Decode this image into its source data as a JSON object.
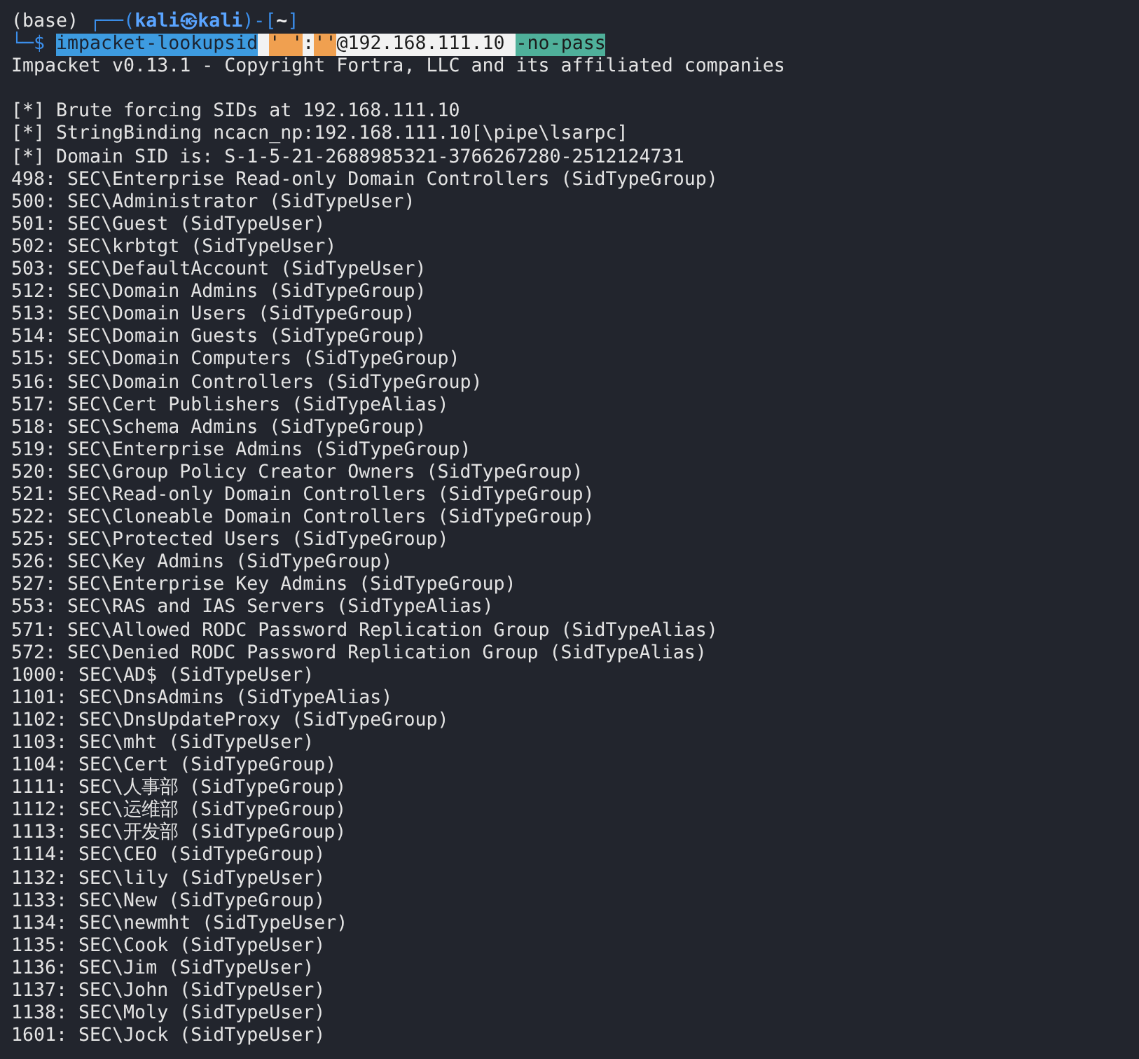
{
  "prompt": {
    "env": "(base)",
    "frame_open": "┌──(",
    "user": "kali",
    "at": "㉿",
    "host": "kali",
    "frame_mid": ")-[",
    "path": "~",
    "frame_close": "]",
    "corner": "└─",
    "symbol": "$",
    "segments": [
      {
        "text": "impacket-lookupsid",
        "kind": "command"
      },
      {
        "text": "' '",
        "kind": "string"
      },
      {
        "text": ":",
        "kind": "highlight"
      },
      {
        "text": "''",
        "kind": "string"
      },
      {
        "text": "@192.168.111.10 ",
        "kind": "highlight"
      },
      {
        "text": "-no-pass",
        "kind": "option"
      }
    ]
  },
  "banner": "Impacket v0.13.1 - Copyright Fortra, LLC and its affiliated companies",
  "status_lines": [
    "[*] Brute forcing SIDs at 192.168.111.10",
    "[*] StringBinding ncacn_np:192.168.111.10[\\pipe\\lsarpc]",
    "[*] Domain SID is: S-1-5-21-2688985321-3766267280-2512124731"
  ],
  "sids": [
    "498: SEC\\Enterprise Read-only Domain Controllers (SidTypeGroup)",
    "500: SEC\\Administrator (SidTypeUser)",
    "501: SEC\\Guest (SidTypeUser)",
    "502: SEC\\krbtgt (SidTypeUser)",
    "503: SEC\\DefaultAccount (SidTypeUser)",
    "512: SEC\\Domain Admins (SidTypeGroup)",
    "513: SEC\\Domain Users (SidTypeGroup)",
    "514: SEC\\Domain Guests (SidTypeGroup)",
    "515: SEC\\Domain Computers (SidTypeGroup)",
    "516: SEC\\Domain Controllers (SidTypeGroup)",
    "517: SEC\\Cert Publishers (SidTypeAlias)",
    "518: SEC\\Schema Admins (SidTypeGroup)",
    "519: SEC\\Enterprise Admins (SidTypeGroup)",
    "520: SEC\\Group Policy Creator Owners (SidTypeGroup)",
    "521: SEC\\Read-only Domain Controllers (SidTypeGroup)",
    "522: SEC\\Cloneable Domain Controllers (SidTypeGroup)",
    "525: SEC\\Protected Users (SidTypeGroup)",
    "526: SEC\\Key Admins (SidTypeGroup)",
    "527: SEC\\Enterprise Key Admins (SidTypeGroup)",
    "553: SEC\\RAS and IAS Servers (SidTypeAlias)",
    "571: SEC\\Allowed RODC Password Replication Group (SidTypeAlias)",
    "572: SEC\\Denied RODC Password Replication Group (SidTypeAlias)",
    "1000: SEC\\AD$ (SidTypeUser)",
    "1101: SEC\\DnsAdmins (SidTypeAlias)",
    "1102: SEC\\DnsUpdateProxy (SidTypeGroup)",
    "1103: SEC\\mht (SidTypeUser)",
    "1104: SEC\\Cert (SidTypeGroup)",
    "1111: SEC\\人事部 (SidTypeGroup)",
    "1112: SEC\\运维部 (SidTypeGroup)",
    "1113: SEC\\开发部 (SidTypeGroup)",
    "1114: SEC\\CEO (SidTypeGroup)",
    "1132: SEC\\lily (SidTypeUser)",
    "1133: SEC\\New (SidTypeGroup)",
    "1134: SEC\\newmht (SidTypeUser)",
    "1135: SEC\\Cook (SidTypeUser)",
    "1136: SEC\\Jim (SidTypeUser)",
    "1137: SEC\\John (SidTypeUser)",
    "1138: SEC\\Moly (SidTypeUser)",
    "1601: SEC\\Jock (SidTypeUser)"
  ]
}
